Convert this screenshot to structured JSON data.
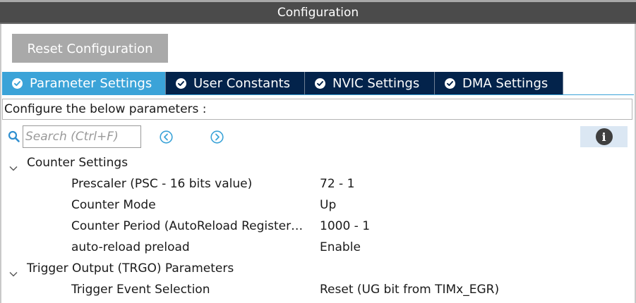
{
  "window": {
    "title": "Configuration"
  },
  "toolbar": {
    "reset_label": "Reset Configuration"
  },
  "tabs": [
    {
      "label": "Parameter Settings",
      "active": true,
      "icon": "check-circle-icon"
    },
    {
      "label": "User Constants",
      "active": false,
      "icon": "check-circle-icon"
    },
    {
      "label": "NVIC Settings",
      "active": false,
      "icon": "check-circle-icon"
    },
    {
      "label": "DMA Settings",
      "active": false,
      "icon": "check-circle-icon"
    }
  ],
  "instructions": "Configure the below parameters :",
  "search": {
    "placeholder": "Search (Ctrl+F)",
    "value": ""
  },
  "icons": {
    "search": "search-icon",
    "prev": "arrow-left-circle-icon",
    "next": "arrow-right-circle-icon",
    "info": "info-icon"
  },
  "colors": {
    "tab_active": "#3ba3d8",
    "tab_inactive": "#03234b",
    "title_bar": "#4b4b4b",
    "reset_button": "#a9a9a9",
    "icon_accent": "#3ba3d8"
  },
  "groups": [
    {
      "label": "Counter Settings",
      "expanded": true,
      "params": [
        {
          "name": "Prescaler (PSC - 16 bits value)",
          "value": "72 - 1"
        },
        {
          "name": "Counter Mode",
          "value": "Up"
        },
        {
          "name": "Counter Period (AutoReload Register…",
          "value": "1000 - 1"
        },
        {
          "name": "auto-reload preload",
          "value": "Enable"
        }
      ]
    },
    {
      "label": "Trigger Output (TRGO) Parameters",
      "expanded": true,
      "params": [
        {
          "name": "Trigger Event Selection",
          "value": "Reset (UG bit from TIMx_EGR)"
        }
      ]
    }
  ]
}
